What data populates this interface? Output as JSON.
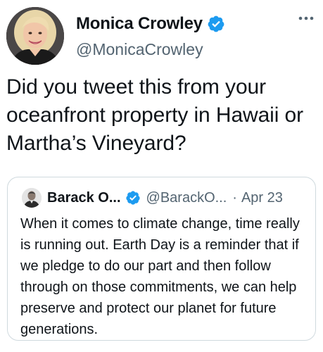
{
  "tweet": {
    "author": {
      "name": "Monica Crowley",
      "handle": "@MonicaCrowley",
      "verified": true
    },
    "text": "Did you tweet this from your oceanfront property in Hawaii or Martha’s Vineyard?",
    "more_icon": "more-horizontal-icon"
  },
  "quoted_tweet": {
    "author": {
      "name": "Barack O...",
      "handle": "@BarackO...",
      "verified": true
    },
    "separator": "·",
    "date": "Apr 23",
    "text": "When it comes to climate change, time really is running out. Earth Day is a reminder that if we pledge to do our part and then follow through on those commitments, we can help preserve and protect our planet for future generations."
  },
  "colors": {
    "verified_blue": "#1d9bf0",
    "secondary_text": "#536471",
    "border": "#cfd9de",
    "primary_text": "#0f1419"
  }
}
